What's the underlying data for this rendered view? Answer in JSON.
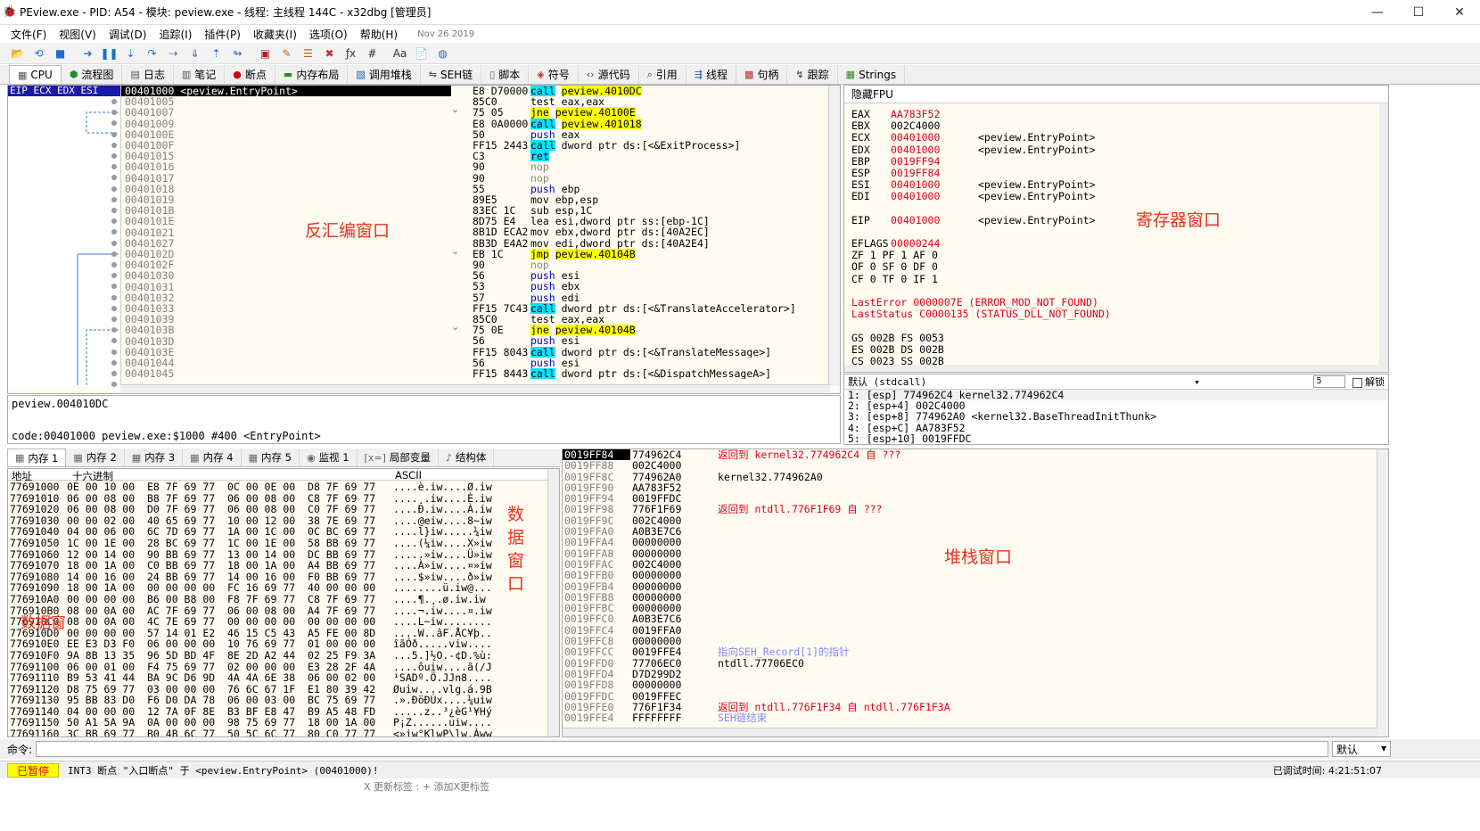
{
  "window": {
    "title": "PEview.exe - PID: A54 - 模块: peview.exe - 线程: 主线程 144C - x32dbg [管理员]",
    "icon": "bug-icon"
  },
  "menu": {
    "items": [
      "文件(F)",
      "视图(V)",
      "调试(D)",
      "追踪(I)",
      "插件(P)",
      "收藏夹(I)",
      "选项(O)",
      "帮助(H)"
    ],
    "date": "Nov 26 2019"
  },
  "toolbar": {
    "icons": [
      "open-icon",
      "restart-icon",
      "stop-icon",
      "run-icon",
      "pause-icon",
      "step-into-icon",
      "step-over-icon",
      "trace-into-icon",
      "trace-over-icon",
      "execute-till-return-icon",
      "run-to-user-icon",
      "patch-icon",
      "comment-icon",
      "label-icon",
      "bookmark-icon",
      "function-icon",
      "hash-icon",
      "font-icon",
      "script-icon",
      "globe-icon"
    ]
  },
  "tabs": [
    {
      "label": "CPU",
      "icon": "cpu-icon"
    },
    {
      "label": "流程图",
      "icon": "graph-icon"
    },
    {
      "label": "日志",
      "icon": "log-icon"
    },
    {
      "label": "笔记",
      "icon": "notes-icon"
    },
    {
      "label": "断点",
      "icon": "breakpoint-icon"
    },
    {
      "label": "内存布局",
      "icon": "memory-map-icon"
    },
    {
      "label": "调用堆栈",
      "icon": "callstack-icon"
    },
    {
      "label": "SEH链",
      "icon": "seh-icon"
    },
    {
      "label": "脚本",
      "icon": "script-icon"
    },
    {
      "label": "符号",
      "icon": "symbol-icon"
    },
    {
      "label": "源代码",
      "icon": "source-icon"
    },
    {
      "label": "引用",
      "icon": "reference-icon"
    },
    {
      "label": "线程",
      "icon": "thread-icon"
    },
    {
      "label": "句柄",
      "icon": "handle-icon"
    },
    {
      "label": "跟踪",
      "icon": "trace-icon"
    },
    {
      "label": "Strings",
      "icon": "strings-icon"
    }
  ],
  "disasm": {
    "reg_strip": "EIP ECX EDX ESI",
    "label": "反汇编窗口",
    "rows": [
      {
        "addr": "00401000 <peview.EntryPoint>",
        "bytes": "E8 D70000",
        "mn": "call",
        "op": "peview.4010DC",
        "t": "call"
      },
      {
        "addr": "00401005",
        "bytes": "85C0",
        "mn": "test",
        "op": "eax,eax",
        "t": ""
      },
      {
        "addr": "00401007",
        "bytes": "75 05",
        "mn": "jne",
        "op": "peview.40100E",
        "t": "jmp"
      },
      {
        "addr": "00401009",
        "bytes": "E8 0A0000",
        "mn": "call",
        "op": "peview.401018",
        "t": "call"
      },
      {
        "addr": "0040100E",
        "bytes": "50",
        "mn": "push",
        "op": "eax",
        "t": "push"
      },
      {
        "addr": "0040100F",
        "bytes": "FF15 2443",
        "mn": "call",
        "op": "dword ptr ds:[<&ExitProcess>]",
        "t": "call"
      },
      {
        "addr": "00401015",
        "bytes": "C3",
        "mn": "ret",
        "op": "",
        "t": "call"
      },
      {
        "addr": "00401016",
        "bytes": "90",
        "mn": "nop",
        "op": "",
        "t": "nop"
      },
      {
        "addr": "00401017",
        "bytes": "90",
        "mn": "nop",
        "op": "",
        "t": "nop"
      },
      {
        "addr": "00401018",
        "bytes": "55",
        "mn": "push",
        "op": "ebp",
        "t": "push"
      },
      {
        "addr": "00401019",
        "bytes": "89E5",
        "mn": "mov",
        "op": "ebp,esp",
        "t": ""
      },
      {
        "addr": "0040101B",
        "bytes": "83EC 1C",
        "mn": "sub",
        "op": "esp,1C",
        "t": ""
      },
      {
        "addr": "0040101E",
        "bytes": "8D75 E4",
        "mn": "lea",
        "op": "esi,dword ptr ss:[ebp-1C]",
        "t": ""
      },
      {
        "addr": "00401021",
        "bytes": "8B1D ECA2",
        "mn": "mov",
        "op": "ebx,dword ptr ds:[40A2EC]",
        "t": ""
      },
      {
        "addr": "00401027",
        "bytes": "8B3D E4A2",
        "mn": "mov",
        "op": "edi,dword ptr ds:[40A2E4]",
        "t": ""
      },
      {
        "addr": "0040102D",
        "bytes": "EB 1C",
        "mn": "jmp",
        "op": "peview.40104B",
        "t": "jmp"
      },
      {
        "addr": "0040102F",
        "bytes": "90",
        "mn": "nop",
        "op": "",
        "t": "nop"
      },
      {
        "addr": "00401030",
        "bytes": "56",
        "mn": "push",
        "op": "esi",
        "t": "push"
      },
      {
        "addr": "00401031",
        "bytes": "53",
        "mn": "push",
        "op": "ebx",
        "t": "push"
      },
      {
        "addr": "00401032",
        "bytes": "57",
        "mn": "push",
        "op": "edi",
        "t": "push"
      },
      {
        "addr": "00401033",
        "bytes": "FF15 7C43",
        "mn": "call",
        "op": "dword ptr ds:[<&TranslateAccelerator>]",
        "t": "call"
      },
      {
        "addr": "00401039",
        "bytes": "85C0",
        "mn": "test",
        "op": "eax,eax",
        "t": ""
      },
      {
        "addr": "0040103B",
        "bytes": "75 0E",
        "mn": "jne",
        "op": "peview.40104B",
        "t": "jmp"
      },
      {
        "addr": "0040103D",
        "bytes": "56",
        "mn": "push",
        "op": "esi",
        "t": "push"
      },
      {
        "addr": "0040103E",
        "bytes": "FF15 8043",
        "mn": "call",
        "op": "dword ptr ds:[<&TranslateMessage>]",
        "t": "call"
      },
      {
        "addr": "00401044",
        "bytes": "56",
        "mn": "push",
        "op": "esi",
        "t": "push"
      },
      {
        "addr": "00401045",
        "bytes": "FF15 8443",
        "mn": "call",
        "op": "dword ptr ds:[<&DispatchMessageA>]",
        "t": "call"
      }
    ],
    "info_line1": "peview.004010DC",
    "info_line2": "code:00401000 peview.exe:$1000 #400 <EntryPoint>"
  },
  "registers": {
    "header": "隐藏FPU",
    "label": "寄存器窗口",
    "rows": [
      {
        "n": "EAX",
        "v": "AA783F52",
        "c": ""
      },
      {
        "n": "EBX",
        "v": "002C4000",
        "c": "",
        "blk": true
      },
      {
        "n": "ECX",
        "v": "00401000",
        "c": "<peview.EntryPoint>"
      },
      {
        "n": "EDX",
        "v": "00401000",
        "c": "<peview.EntryPoint>"
      },
      {
        "n": "EBP",
        "v": "0019FF94",
        "c": ""
      },
      {
        "n": "ESP",
        "v": "0019FF84",
        "c": ""
      },
      {
        "n": "ESI",
        "v": "00401000",
        "c": "<peview.EntryPoint>"
      },
      {
        "n": "EDI",
        "v": "00401000",
        "c": "<peview.EntryPoint>"
      },
      {
        "n": "",
        "v": "",
        "c": ""
      },
      {
        "n": "EIP",
        "v": "00401000",
        "c": "<peview.EntryPoint>"
      },
      {
        "n": "",
        "v": "",
        "c": ""
      },
      {
        "n": "EFLAGS",
        "v": "00000244",
        "c": ""
      }
    ],
    "flags": [
      "ZF 1  PF 1  AF 0",
      "OF 0  SF 0  DF 0",
      "CF 0  TF 0  IF 1"
    ],
    "last_error": "LastError  0000007E (ERROR_MOD_NOT_FOUND)",
    "last_status": "LastStatus C0000135 (STATUS_DLL_NOT_FOUND)",
    "segs": [
      "GS 002B  FS 0053",
      "ES 002B  DS 002B",
      "CS 0023  SS 002B"
    ]
  },
  "args": {
    "convention": "默认 (stdcall)",
    "count": "5",
    "unlock_label": "解锁",
    "rows": [
      "1: [esp] 774962C4 kernel32.774962C4",
      "2: [esp+4] 002C4000",
      "3: [esp+8] 774962A0 <kernel32.BaseThreadInitThunk>",
      "4: [esp+C] AA783F52",
      "5: [esp+10] 0019FFDC"
    ]
  },
  "memtabs": [
    {
      "label": "内存 1",
      "icon": "memory-icon"
    },
    {
      "label": "内存 2",
      "icon": "memory-icon"
    },
    {
      "label": "内存 3",
      "icon": "memory-icon"
    },
    {
      "label": "内存 4",
      "icon": "memory-icon"
    },
    {
      "label": "内存 5",
      "icon": "memory-icon"
    },
    {
      "label": "监视 1",
      "icon": "watch-icon"
    },
    {
      "label": "局部变量",
      "icon": "locals-icon"
    },
    {
      "label": "结构体",
      "icon": "struct-icon"
    }
  ],
  "dump": {
    "headers": {
      "addr": "地址",
      "hex": "十六进制",
      "ascii": "ASCII"
    },
    "label": "数据窗口",
    "overlay": "数据窗",
    "rows": [
      {
        "a": "77691000",
        "h": "0E 00 10 00  E8 7F 69 77  0C 00 0E 00  D8 7F 69 77",
        "s": "....è.iw....Ø.iw"
      },
      {
        "a": "77691010",
        "h": "06 00 08 00  B8 7F 69 77  06 00 08 00  C8 7F 69 77",
        "s": "....¸.iw....È.iw"
      },
      {
        "a": "77691020",
        "h": "06 00 08 00  D0 7F 69 77  06 00 08 00  C0 7F 69 77",
        "s": "....Ð.iw....À.iw"
      },
      {
        "a": "77691030",
        "h": "00 00 02 00  40 65 69 77  10 00 12 00  38 7E 69 77",
        "s": "....@eiw....8~iw"
      },
      {
        "a": "77691040",
        "h": "04 00 06 00  6C 7D 69 77  1A 00 1C 00  0C BC 69 77",
        "s": "....l}iw.....¼iw"
      },
      {
        "a": "77691050",
        "h": "1C 00 1E 00  28 BC 69 77  1C 00 1E 00  58 BB 69 77",
        "s": "....(¼iw....X»iw"
      },
      {
        "a": "77691060",
        "h": "12 00 14 00  90 BB 69 77  13 00 14 00  DC BB 69 77",
        "s": ".....»iw....Ü»iw"
      },
      {
        "a": "77691070",
        "h": "18 00 1A 00  C0 BB 69 77  18 00 1A 00  A4 BB 69 77",
        "s": "....À»iw....¤»iw"
      },
      {
        "a": "77691080",
        "h": "14 00 16 00  24 BB 69 77  14 00 16 00  F0 BB 69 77",
        "s": "....$»iw....ð»iw"
      },
      {
        "a": "77691090",
        "h": "18 00 1A 00  00 00 00 00  FC 16 69 77  40 00 00 00",
        "s": "........ü.iw@..."
      },
      {
        "a": "776910A0",
        "h": "00 00 00 00  B6 00 B8 00  F8 7F 69 77  C8 7F 69 77",
        "s": "....¶.¸.ø.iw.iw"
      },
      {
        "a": "776910B0",
        "h": "08 00 0A 00  AC 7F 69 77  06 00 08 00  A4 7F 69 77",
        "s": "....¬.iw....¤.iw"
      },
      {
        "a": "776910C0",
        "h": "08 00 0A 00  4C 7E 69 77  00 00 00 00  00 00 00 00",
        "s": "....L~iw........"
      },
      {
        "a": "776910D0",
        "h": "00 00 00 00  57 14 01 E2  46 15 C5 43  A5 FE 00 8D",
        "s": "....W..âF.ÅC¥þ.."
      },
      {
        "a": "776910E0",
        "h": "EE E3 D3 F0  06 00 00 00  10 76 69 77  01 00 00 00",
        "s": "îãÓð.....viw...."
      },
      {
        "a": "776910F0",
        "h": "9A 8B 13 35  96 5D BD 4F  8E 2D A2 44  02 25 F9 3A",
        "s": "...5.]½O.-¢D.%ù:"
      },
      {
        "a": "77691100",
        "h": "06 00 01 00  F4 75 69 77  02 00 00 00  E3 28 2F 4A",
        "s": "....ôuiw....ã(/J"
      },
      {
        "a": "77691110",
        "h": "B9 53 41 44  BA 9C D6 9D  4A 4A 6E 38  06 00 02 00",
        "s": "¹SADº.Ö.JJn8...."
      },
      {
        "a": "77691120",
        "h": "D8 75 69 77  03 00 00 00  76 6C 67 1F  E1 80 39 42",
        "s": "Øuiw....vlg.á.9B"
      },
      {
        "a": "77691130",
        "h": "95 BB 83 D0  F6 D0 DA 78  06 00 03 00  BC 75 69 77",
        "s": ".».ÐöÐÚx....¼uiw"
      },
      {
        "a": "77691140",
        "h": "04 00 00 00  12 7A 0F 8E  B3 BF E8 47  B9 A5 48 FD",
        "s": ".....z..³¿èG¹¥Hý"
      },
      {
        "a": "77691150",
        "h": "50 A1 5A 9A  0A 00 00 00  98 75 69 77  18 00 1A 00",
        "s": "P¡Z......uiw...."
      },
      {
        "a": "77691160",
        "h": "3C BB 69 77  B0 4B 6C 77  50 5C 6C 77  80 C0 77 77",
        "s": "<»iw°KlwP\\lw.Àww"
      }
    ]
  },
  "stack": {
    "label": "堆栈窗口",
    "rows": [
      {
        "a": "0019FF84",
        "v": "774962C4",
        "c": "返回到 kernel32.774962C4 自 ???",
        "k": "red"
      },
      {
        "a": "0019FF88",
        "v": "002C4000",
        "c": "",
        "k": ""
      },
      {
        "a": "0019FF8C",
        "v": "774962A0",
        "c": "kernel32.774962A0",
        "k": "blk"
      },
      {
        "a": "0019FF90",
        "v": "AA783F52",
        "c": "",
        "k": ""
      },
      {
        "a": "0019FF94",
        "v": "0019FFDC",
        "c": "",
        "k": ""
      },
      {
        "a": "0019FF98",
        "v": "776F1F69",
        "c": "返回到 ntdll.776F1F69 自 ???",
        "k": "red"
      },
      {
        "a": "0019FF9C",
        "v": "002C4000",
        "c": "",
        "k": ""
      },
      {
        "a": "0019FFA0",
        "v": "A0B3E7C6",
        "c": "",
        "k": ""
      },
      {
        "a": "0019FFA4",
        "v": "00000000",
        "c": "",
        "k": ""
      },
      {
        "a": "0019FFA8",
        "v": "00000000",
        "c": "",
        "k": ""
      },
      {
        "a": "0019FFAC",
        "v": "002C4000",
        "c": "",
        "k": ""
      },
      {
        "a": "0019FFB0",
        "v": "00000000",
        "c": "",
        "k": ""
      },
      {
        "a": "0019FFB4",
        "v": "00000000",
        "c": "",
        "k": ""
      },
      {
        "a": "0019FFB8",
        "v": "00000000",
        "c": "",
        "k": ""
      },
      {
        "a": "0019FFBC",
        "v": "00000000",
        "c": "",
        "k": ""
      },
      {
        "a": "0019FFC0",
        "v": "A0B3E7C6",
        "c": "",
        "k": ""
      },
      {
        "a": "0019FFC4",
        "v": "0019FFA0",
        "c": "",
        "k": ""
      },
      {
        "a": "0019FFC8",
        "v": "00000000",
        "c": "",
        "k": ""
      },
      {
        "a": "0019FFCC",
        "v": "0019FFE4",
        "c": "指向SEH_Record[1]的指针",
        "k": "seh"
      },
      {
        "a": "0019FFD0",
        "v": "77706EC0",
        "c": "ntdll.77706EC0",
        "k": "blk"
      },
      {
        "a": "0019FFD4",
        "v": "D7D299D2",
        "c": "",
        "k": ""
      },
      {
        "a": "0019FFD8",
        "v": "00000000",
        "c": "",
        "k": ""
      },
      {
        "a": "0019FFDC",
        "v": "0019FFEC",
        "c": "",
        "k": ""
      },
      {
        "a": "0019FFE0",
        "v": "776F1F34",
        "c": "返回到 ntdll.776F1F34 自 ntdll.776F1F3A",
        "k": "red"
      },
      {
        "a": "0019FFE4",
        "v": "FFFFFFFF",
        "c": "SEH链结束",
        "k": "seh"
      }
    ]
  },
  "command": {
    "label": "命令:",
    "mode": "默认"
  },
  "status": {
    "state": "已暂停",
    "message": "INT3 断点 \"入口断点\" 于 <peview.EntryPoint> (00401000)!",
    "time": "已调试时间:   4:21:51:07"
  },
  "bottom_strip": "X 更新标签 :    + 添加X更标签"
}
